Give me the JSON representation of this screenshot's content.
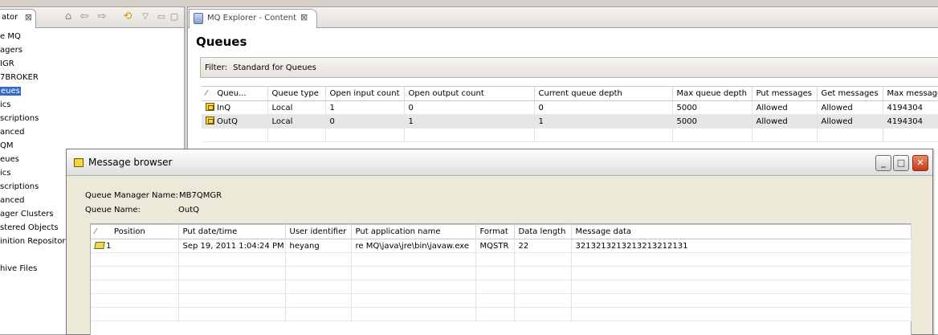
{
  "navigator": {
    "tab_label": "ator",
    "close_glyph": "⊠",
    "toolbar_icons": [
      "home-icon",
      "back-arrow-icon",
      "forward-arrow-icon",
      "sync-icon",
      "view-menu-icon",
      "minimize-icon",
      "maximize-icon"
    ],
    "items": [
      {
        "label": "e MQ"
      },
      {
        "label": "agers"
      },
      {
        "label": "IGR"
      },
      {
        "label": "7BROKER"
      },
      {
        "label": "eues",
        "selected": true
      },
      {
        "label": "ics"
      },
      {
        "label": "scriptions"
      },
      {
        "label": "anced"
      },
      {
        "label": "QM"
      },
      {
        "label": "eues"
      },
      {
        "label": "ics"
      },
      {
        "label": "scriptions"
      },
      {
        "label": "anced"
      },
      {
        "label": "ager Clusters"
      },
      {
        "label": "stered Objects"
      },
      {
        "label": "inition Repositori"
      },
      {
        "label": ""
      },
      {
        "label": "hive Files"
      }
    ]
  },
  "content": {
    "tab_label": "MQ Explorer - Content",
    "close_glyph": "⊠",
    "page_title": "Queues",
    "filter_label": "Filter:",
    "filter_value": "Standard for Queues",
    "queue_table": {
      "columns": [
        "Queu...",
        "Queue type",
        "Open input count",
        "Open output count",
        "Current queue depth",
        "Max queue depth",
        "Put messages",
        "Get messages",
        "Max message"
      ],
      "rows": [
        [
          "InQ",
          "Local",
          "1",
          "0",
          "0",
          "5000",
          "Allowed",
          "Allowed",
          "4194304"
        ],
        [
          "OutQ",
          "Local",
          "0",
          "1",
          "1",
          "5000",
          "Allowed",
          "Allowed",
          "4194304"
        ]
      ]
    }
  },
  "dialog": {
    "title": "Message browser",
    "queue_manager_label": "Queue Manager Name:",
    "queue_manager_value": "MB7QMGR",
    "queue_name_label": "Queue Name:",
    "queue_name_value": "OutQ",
    "message_table": {
      "columns": [
        "Position",
        "Put date/time",
        "User identifier",
        "Put application name",
        "Format",
        "Data length",
        "Message data"
      ],
      "rows": [
        [
          "1",
          "Sep 19, 2011 1:04:24 PM",
          "heyang",
          "re MQ\\java\\jre\\bin\\javaw.exe",
          "MQSTR",
          "22",
          "3213213213213213212131"
        ]
      ]
    }
  }
}
